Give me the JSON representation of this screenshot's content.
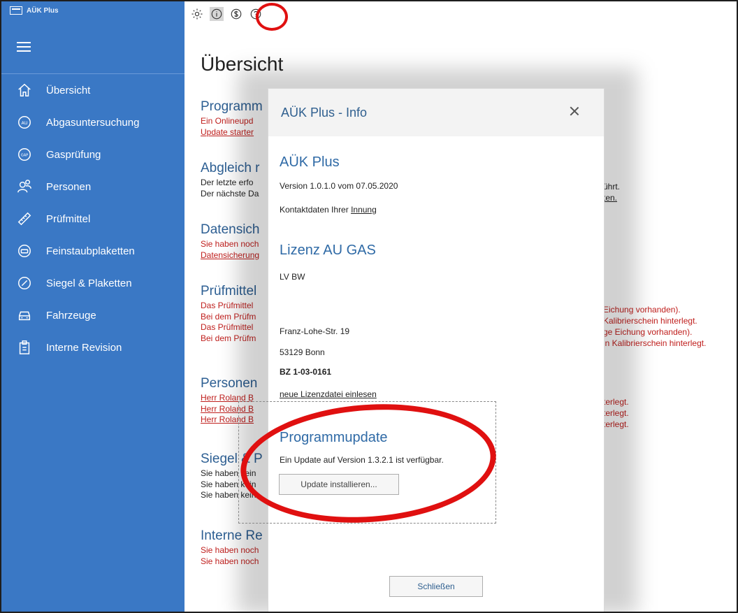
{
  "app": {
    "title": "AÜK Plus"
  },
  "toolbar": {
    "items": [
      {
        "icon": "gear-icon"
      },
      {
        "icon": "info-icon"
      },
      {
        "icon": "dollar-icon"
      },
      {
        "icon": "help-icon"
      }
    ]
  },
  "sidebar": {
    "items": [
      {
        "label": "Übersicht",
        "icon": "home-icon"
      },
      {
        "label": "Abgasuntersuchung",
        "icon": "au-icon"
      },
      {
        "label": "Gasprüfung",
        "icon": "gap-icon"
      },
      {
        "label": "Personen",
        "icon": "persons-icon"
      },
      {
        "label": "Prüfmittel",
        "icon": "ruler-icon"
      },
      {
        "label": "Feinstaubplaketten",
        "icon": "plaque-icon"
      },
      {
        "label": "Siegel & Plaketten",
        "icon": "seal-icon"
      },
      {
        "label": "Fahrzeuge",
        "icon": "car-icon"
      },
      {
        "label": "Interne Revision",
        "icon": "clipboard-icon"
      }
    ]
  },
  "main": {
    "title": "Übersicht",
    "sections": {
      "programm": {
        "title": "Programm",
        "l1": "Ein Onlineupd",
        "l2": "Update starter"
      },
      "abgleich": {
        "title": "Abgleich r",
        "l1": "Der letzte erfo",
        "l2": "Der nächste Da",
        "r1": "ührt.",
        "r2": "ten."
      },
      "datensich": {
        "title": "Datensich",
        "l1": "Sie haben noch",
        "l2": "Datensicherung"
      },
      "pruefmittel": {
        "title": "Prüfmittel",
        "l1": "Das Prüfmittel",
        "l2": "Bei dem Prüfm",
        "l3": "Das Prüfmittel",
        "l4": "Bei dem Prüfm",
        "r1": "Eichung vorhanden).",
        "r2": "Kalibrierschein hinterlegt.",
        "r3": "ge Eichung vorhanden).",
        "r4": "in Kalibrierschein hinterlegt."
      },
      "personen": {
        "title": "Personen",
        "l1": "Herr Roland B",
        "l2": "Herr Roland B",
        "l3": "Herr Roland B",
        "r1": "terlegt.",
        "r2": "terlegt.",
        "r3": "terlegt."
      },
      "siegel": {
        "title": "Siegel & P",
        "l1": "Sie haben kein",
        "l2": "Sie haben kein",
        "l3": "Sie haben kein"
      },
      "interne": {
        "title": "Interne Re",
        "l1": "Sie haben noch",
        "l2": "Sie haben noch"
      }
    }
  },
  "dialog": {
    "title": "AÜK Plus - Info",
    "product": "AÜK Plus",
    "version": "Version 1.0.1.0 vom 07.05.2020",
    "contact_prefix": "Kontaktdaten Ihrer ",
    "contact_link": "Innung",
    "license_title": "Lizenz  AU  GAS",
    "licensee": "LV BW",
    "street": "Franz-Lohe-Str. 19",
    "city": "53129 Bonn",
    "bz": "BZ 1-03-0161",
    "new_license_link": "neue Lizenzdatei einlesen",
    "update_title": "Programmupdate",
    "update_text": "Ein Update auf Version 1.3.2.1 ist verfügbar.",
    "update_button": "Update installieren...",
    "close_button": "Schließen"
  },
  "annotation_color": "#e01010"
}
